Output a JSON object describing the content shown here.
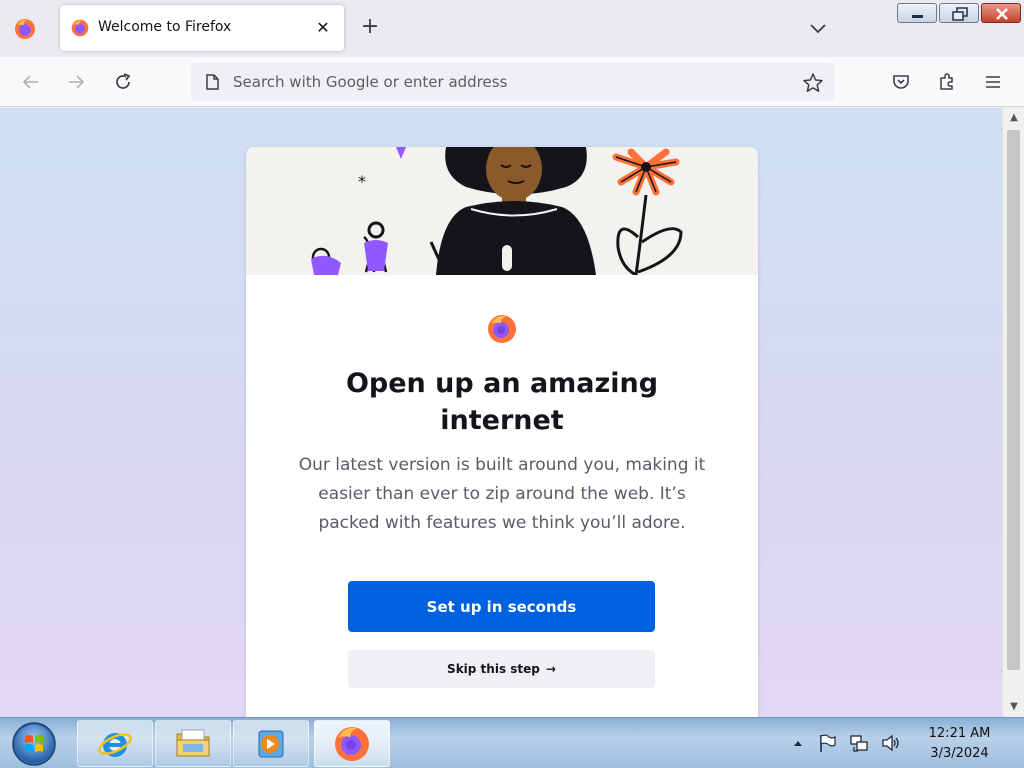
{
  "tab": {
    "title": "Welcome to Firefox",
    "close_glyph": "✕"
  },
  "new_tab_glyph": "+",
  "urlbar": {
    "placeholder": "Search with Google or enter address"
  },
  "welcome": {
    "headline": "Open up an amazing internet",
    "subtext": "Our latest version is built around you, making it easier than ever to zip around the web. It’s packed with features we think you’ll adore.",
    "primary_button": "Set up in seconds",
    "secondary_button": "Skip this step",
    "secondary_arrow": "→"
  },
  "scrollbar": {
    "up_glyph": "▲",
    "down_glyph": "▼"
  },
  "taskbar": {
    "clock_time": "12:21 AM",
    "clock_date": "3/3/2024"
  },
  "colors": {
    "accent": "#0061e0",
    "firefox_orange": "#ff7139",
    "firefox_purple": "#9059ff"
  },
  "icons": [
    "firefox-menu-icon",
    "firefox-favicon-icon",
    "close-icon",
    "plus-icon",
    "chevron-down-icon",
    "minimize-icon",
    "restore-icon",
    "window-close-icon",
    "back-arrow-icon",
    "forward-arrow-icon",
    "reload-icon",
    "page-icon",
    "star-icon",
    "pocket-icon",
    "extensions-icon",
    "hamburger-menu-icon",
    "windows-start-icon",
    "internet-explorer-icon",
    "file-explorer-icon",
    "media-player-icon",
    "firefox-taskbar-icon",
    "action-center-flag-icon",
    "network-icon",
    "volume-icon",
    "show-hidden-icons-icon"
  ]
}
